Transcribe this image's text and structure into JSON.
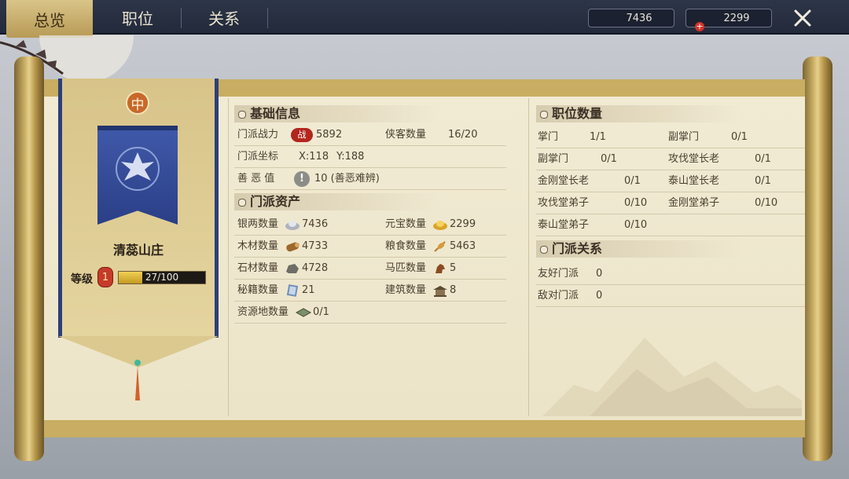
{
  "tabs": [
    {
      "label": "总览",
      "active": true
    },
    {
      "label": "职位",
      "active": false
    },
    {
      "label": "关系",
      "active": false
    }
  ],
  "currencies": [
    {
      "icon": "silver-ingot-icon",
      "value": "7436"
    },
    {
      "icon": "gold-ingot-icon",
      "value": "2299"
    }
  ],
  "colors": {
    "accent": "#c8ad62",
    "banner_blue": "#2c3f7a",
    "level_fill": "#f2cf54"
  },
  "sect": {
    "badge": "中",
    "name": "清蕊山庄",
    "level_label": "等级",
    "level": "1",
    "exp_text": "27/100",
    "exp_fraction": 0.27
  },
  "basic_info": {
    "title": "基础信息",
    "power_label": "门派战力",
    "power_icon_text": "战",
    "power_value": "5892",
    "heroes_label": "侠客数量",
    "heroes_value": "16/20",
    "coord_label": "门派坐标",
    "coord_x": "X:118",
    "coord_y": "Y:188",
    "karma_label": "善 恶 值",
    "karma_icon_text": "!",
    "karma_value": "10 (善恶难辨)"
  },
  "assets": {
    "title": "门派资产",
    "items": [
      {
        "label": "银两数量",
        "icon": "silver-ingot-icon",
        "value": "7436"
      },
      {
        "label": "元宝数量",
        "icon": "gold-ingot-icon",
        "value": "2299"
      },
      {
        "label": "木材数量",
        "icon": "wood-log-icon",
        "value": "4733"
      },
      {
        "label": "粮食数量",
        "icon": "grain-icon",
        "value": "5463"
      },
      {
        "label": "石材数量",
        "icon": "stone-icon",
        "value": "4728"
      },
      {
        "label": "马匹数量",
        "icon": "horse-icon",
        "value": "5"
      },
      {
        "label": "秘籍数量",
        "icon": "scroll-book-icon",
        "value": "21"
      },
      {
        "label": "建筑数量",
        "icon": "building-icon",
        "value": "8"
      },
      {
        "label": "资源地数量",
        "icon": "resource-land-icon",
        "value": "0/1"
      }
    ]
  },
  "positions": {
    "title": "职位数量",
    "items": [
      {
        "label": "掌门",
        "value": "1/1"
      },
      {
        "label": "副掌门",
        "value": "0/1"
      },
      {
        "label": "副掌门",
        "value": "0/1"
      },
      {
        "label": "攻伐堂长老",
        "value": "0/1"
      },
      {
        "label": "金刚堂长老",
        "value": "0/1"
      },
      {
        "label": "泰山堂长老",
        "value": "0/1"
      },
      {
        "label": "攻伐堂弟子",
        "value": "0/10"
      },
      {
        "label": "金刚堂弟子",
        "value": "0/10"
      },
      {
        "label": "泰山堂弟子",
        "value": "0/10"
      }
    ]
  },
  "relations": {
    "title": "门派关系",
    "items": [
      {
        "label": "友好门派",
        "value": "0"
      },
      {
        "label": "敌对门派",
        "value": "0"
      }
    ]
  }
}
